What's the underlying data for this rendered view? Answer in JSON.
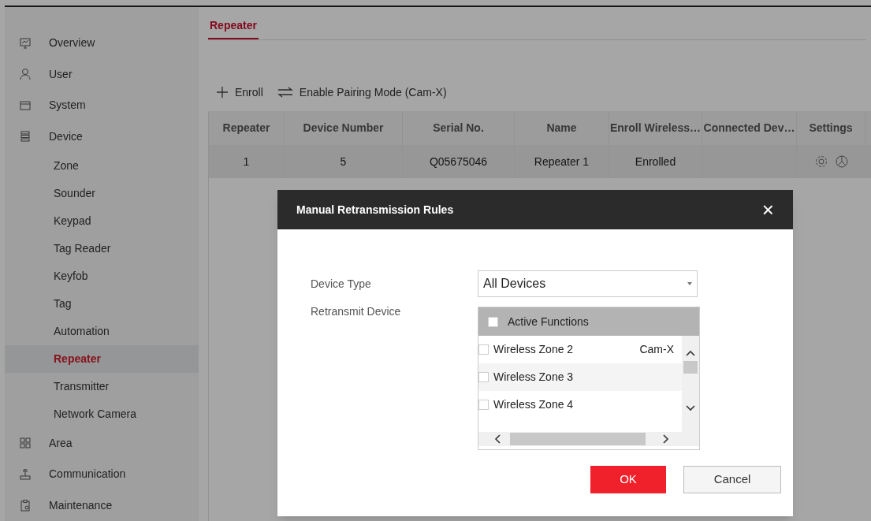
{
  "sidebar": {
    "items": [
      {
        "label": "Overview",
        "selected": false
      },
      {
        "label": "User",
        "selected": false
      },
      {
        "label": "System",
        "selected": false
      },
      {
        "label": "Device",
        "selected": false,
        "children": [
          {
            "label": "Zone",
            "selected": false
          },
          {
            "label": "Sounder",
            "selected": false
          },
          {
            "label": "Keypad",
            "selected": false
          },
          {
            "label": "Tag Reader",
            "selected": false
          },
          {
            "label": "Keyfob",
            "selected": false
          },
          {
            "label": "Tag",
            "selected": false
          },
          {
            "label": "Automation",
            "selected": false
          },
          {
            "label": "Repeater",
            "selected": true
          },
          {
            "label": "Transmitter",
            "selected": false
          },
          {
            "label": "Network Camera",
            "selected": false
          }
        ]
      },
      {
        "label": "Area",
        "selected": false
      },
      {
        "label": "Communication",
        "selected": false
      },
      {
        "label": "Maintenance",
        "selected": false
      }
    ]
  },
  "tabs": [
    {
      "label": "Repeater",
      "selected": true
    }
  ],
  "toolbar": [
    {
      "label": "Enroll"
    },
    {
      "label": "Enable Pairing Mode (Cam-X)"
    }
  ],
  "table": {
    "columns": [
      "Repeater",
      "Device Number",
      "Serial No.",
      "Name",
      "Enroll Wireless…",
      "Connected Dev…",
      "Settings"
    ],
    "rows": [
      {
        "cells": [
          "1",
          "5",
          "Q05675046",
          "Repeater 1",
          "Enrolled",
          ""
        ],
        "selected": true
      }
    ]
  },
  "dialog": {
    "title": "Manual Retransmission Rules",
    "close": "×",
    "device_type": {
      "label": "Device Type",
      "value": "All Devices"
    },
    "retransmit": {
      "label": "Retransmit Device",
      "header": {
        "label": "Active Functions",
        "checked": false
      },
      "items": [
        {
          "label": "Wireless Zone 2",
          "tag": "Cam-X",
          "checked": false
        },
        {
          "label": "Wireless Zone 3",
          "checked": false
        },
        {
          "label": "Wireless Zone 4",
          "checked": false
        }
      ]
    },
    "buttons": [
      {
        "label": "OK",
        "kind": "primary"
      },
      {
        "label": "Cancel",
        "kind": "secondary"
      }
    ]
  }
}
